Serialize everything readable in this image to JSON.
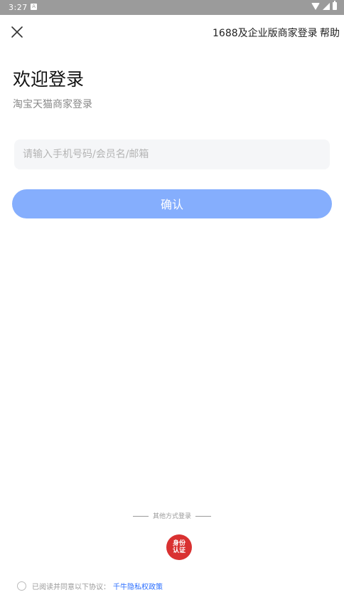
{
  "status_bar": {
    "time": "3:27",
    "notification_icon": "A"
  },
  "header": {
    "close_icon": "close-icon",
    "enterprise_login_link": "1688及企业版商家登录",
    "help_link": "帮助"
  },
  "main": {
    "title": "欢迎登录",
    "subtitle": "淘宝天猫商家登录",
    "account_input": {
      "placeholder": "请输入手机号码/会员名/邮箱",
      "value": ""
    },
    "confirm_button": "确认",
    "confirm_button_color": "#85aefd"
  },
  "footer": {
    "other_login_label": "其他方式登录",
    "id_auth_label": "身份认证",
    "id_auth_color": "#d93131",
    "agreement_text": "已阅读并同意以下协议：",
    "privacy_policy_link": "千牛隐私权政策",
    "link_color": "#2c6fff"
  }
}
